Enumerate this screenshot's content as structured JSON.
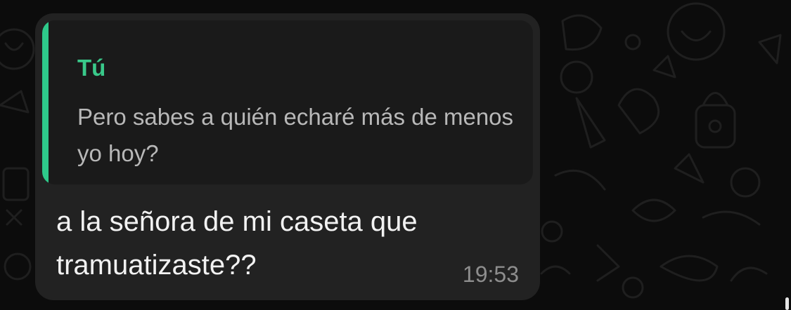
{
  "chat": {
    "message": {
      "quote": {
        "author": "Tú",
        "text": "Pero sabes a quién echaré más de menos yo hoy?"
      },
      "text": "a la señora de mi caseta que tramuatizaste??",
      "time": "19:53"
    }
  },
  "colors": {
    "background": "#0c0c0c",
    "bubble": "#222222",
    "quote_background": "#1a1a1a",
    "quote_accent": "#2ec98a",
    "message_text": "#f2f2f2",
    "timestamp": "#8d8d8d"
  },
  "icons": {
    "wallpaper": "doodle-pattern"
  }
}
